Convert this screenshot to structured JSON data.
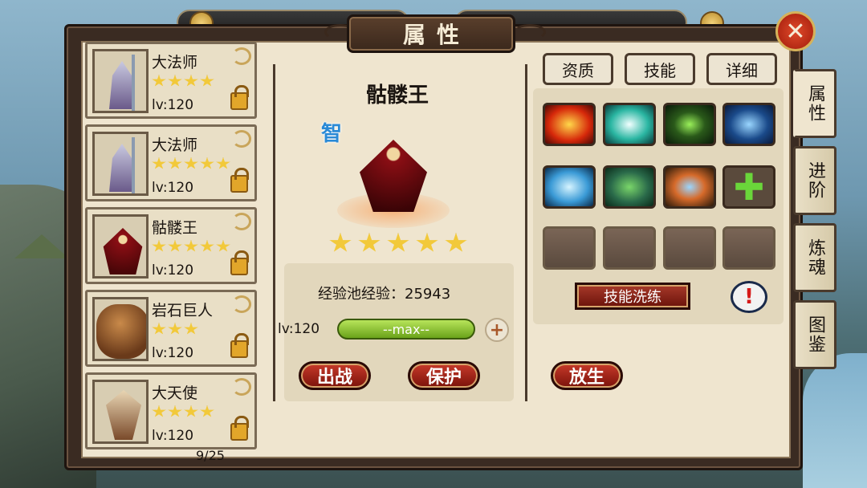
{
  "title": "属性",
  "close_icon": "close-x-icon",
  "hero_list": {
    "count": "9/25",
    "items": [
      {
        "name": "大法师",
        "stars": 4,
        "level": "lv:120",
        "portrait": "archmage"
      },
      {
        "name": "大法师",
        "stars": 5,
        "level": "lv:120",
        "portrait": "archmage"
      },
      {
        "name": "骷髅王",
        "stars": 5,
        "level": "lv:120",
        "portrait": "skeleton-king"
      },
      {
        "name": "岩石巨人",
        "stars": 3,
        "level": "lv:120",
        "portrait": "rock-giant"
      },
      {
        "name": "大天使",
        "stars": 4,
        "level": "lv:120",
        "portrait": "archangel"
      }
    ]
  },
  "detail": {
    "name": "骷髅王",
    "type_badge": "智",
    "stars": 5,
    "exp_pool": "经验池经验：25943",
    "level": "lv:120",
    "exp_bar_text": "--max--",
    "exp_fill": 1.0,
    "buttons": {
      "fight": "出战",
      "protect": "保护",
      "release": "放生"
    }
  },
  "right_tabs": {
    "quality": "资质",
    "skill": "技能",
    "detail": "详细"
  },
  "skills": [
    {
      "icon": "fire-skill-icon"
    },
    {
      "icon": "wind-skill-icon"
    },
    {
      "icon": "spark-skill-icon"
    },
    {
      "icon": "claw-skill-icon"
    },
    {
      "icon": "ice-skill-icon"
    },
    {
      "icon": "frog-skill-icon"
    },
    {
      "icon": "fist-skill-icon"
    },
    {
      "icon": "add-skill-icon"
    },
    {
      "icon": "empty-slot"
    },
    {
      "icon": "empty-slot"
    },
    {
      "icon": "empty-slot"
    },
    {
      "icon": "empty-slot"
    }
  ],
  "skill_wash_label": "技能洗练",
  "side_tabs": [
    "属性",
    "进阶",
    "炼魂",
    "图鉴"
  ],
  "colors": {
    "accent_red": "#a83a2a",
    "exp_green": "#8ac42a",
    "panel_bg": "#efe5cf"
  }
}
